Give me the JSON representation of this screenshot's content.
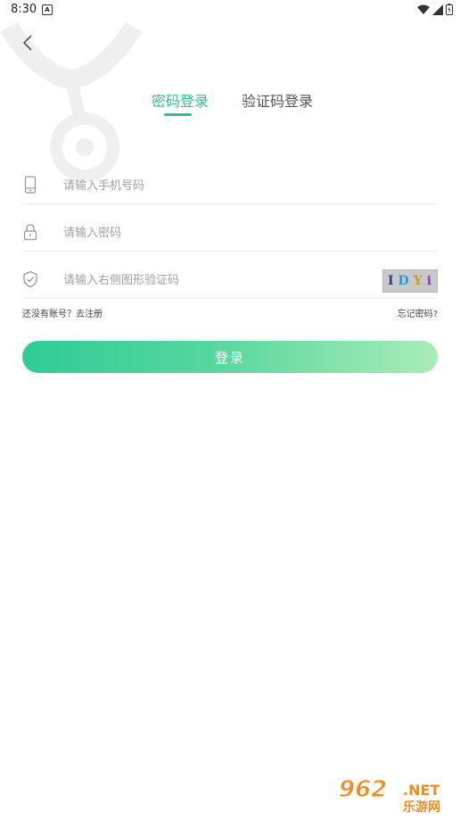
{
  "status_bar": {
    "time": "8:30",
    "notification_glyph": "A",
    "icons": [
      "wifi-icon",
      "signal-icon",
      "battery-icon"
    ]
  },
  "header": {
    "back_icon": "chevron-left-icon"
  },
  "tabs": [
    {
      "label": "密码登录",
      "active": true
    },
    {
      "label": "验证码登录",
      "active": false
    }
  ],
  "form": {
    "phone": {
      "placeholder": "请输入手机号码",
      "value": "",
      "icon": "phone-icon"
    },
    "password": {
      "placeholder": "请输入密码",
      "value": "",
      "icon": "lock-icon"
    },
    "captcha": {
      "placeholder": "请输入右侧图形验证码",
      "value": "",
      "icon": "shield-check-icon",
      "image_chars": [
        "I",
        "D",
        "Y",
        "i"
      ]
    }
  },
  "links": {
    "register": "还没有账号？去注册",
    "forgot": "忘记密码?"
  },
  "login_button": {
    "label": "登录"
  },
  "watermark": {
    "number": "962",
    "domain": ".NET",
    "name": "乐游网"
  },
  "colors": {
    "accent": "#2fbf8f",
    "button_start": "#2fcc95",
    "button_end": "#a9ecb7",
    "watermark": "#f28a1e"
  }
}
